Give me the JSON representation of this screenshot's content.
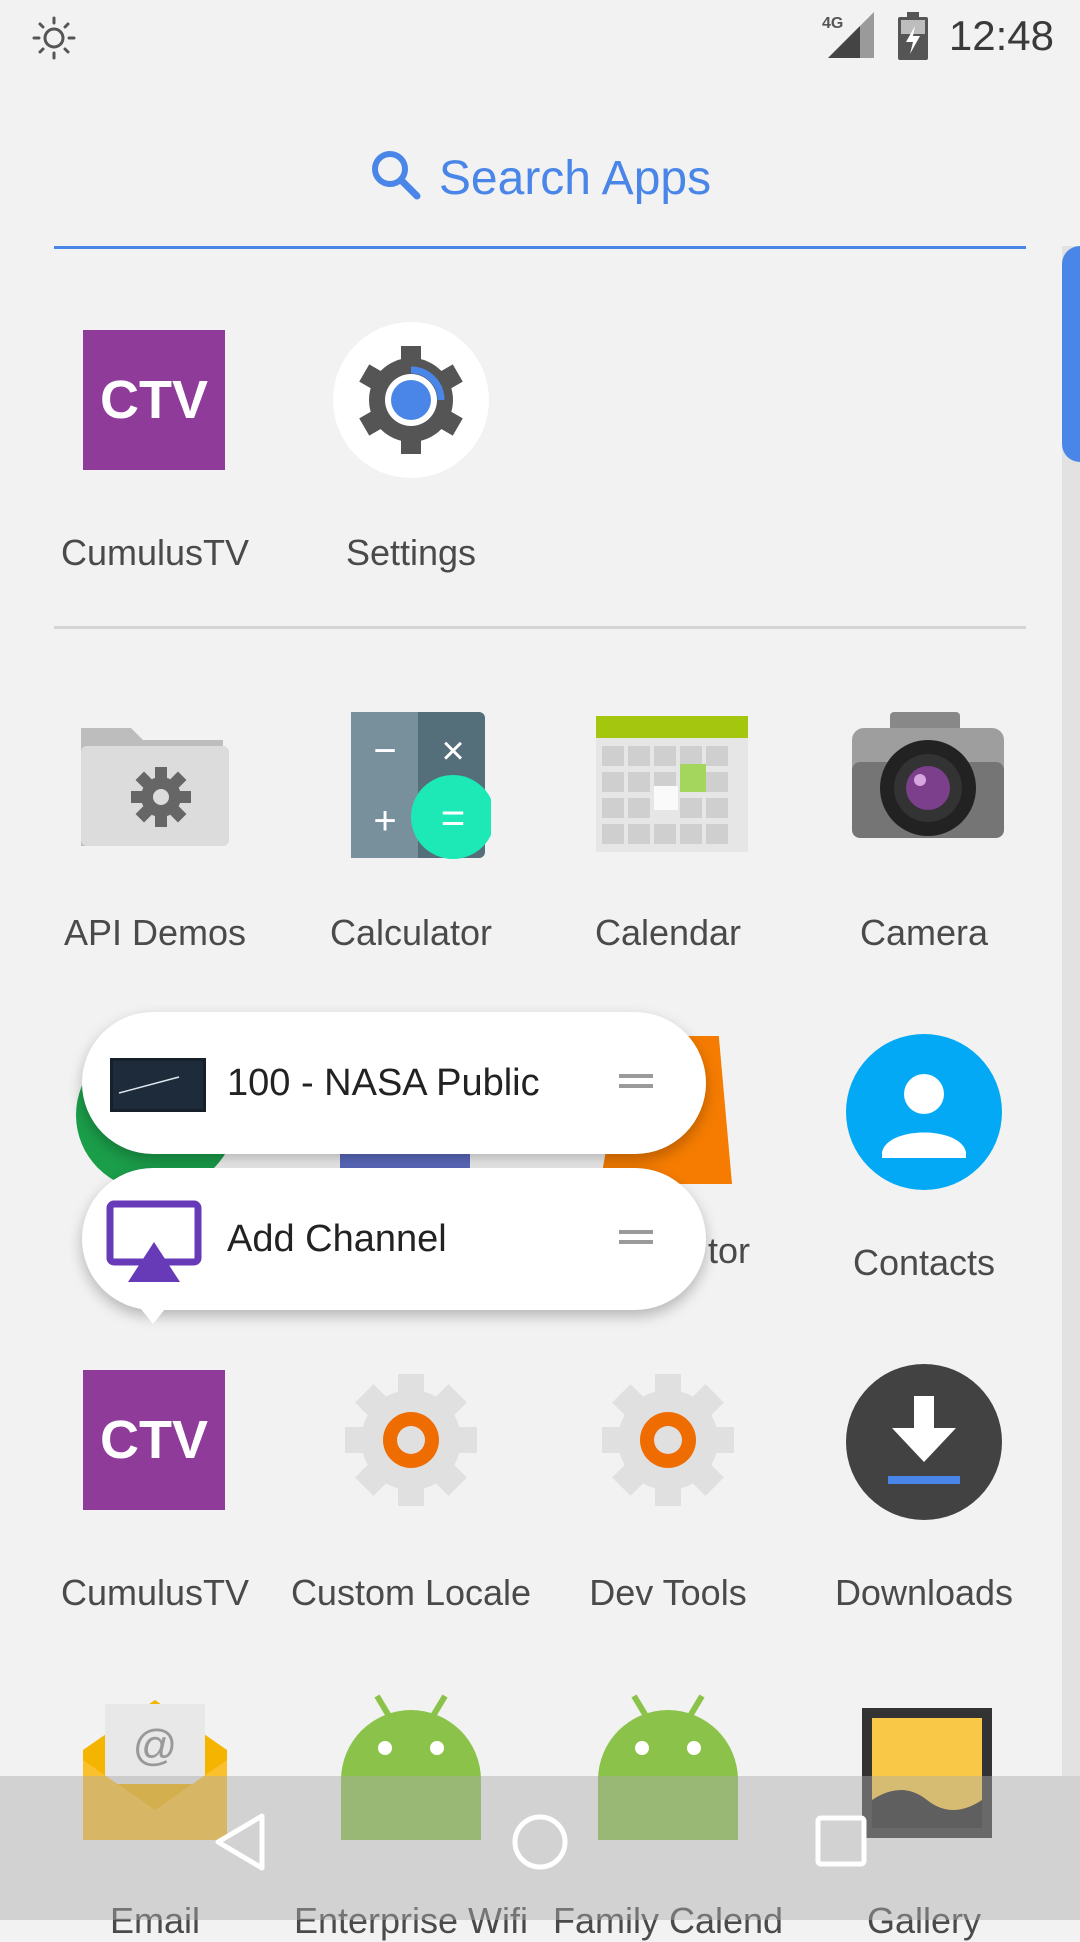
{
  "status_bar": {
    "time": "12:48",
    "network": "4G",
    "icons": [
      "brightness-icon",
      "signal-icon",
      "battery-charging-icon"
    ]
  },
  "search": {
    "placeholder": "Search Apps",
    "icon": "search-icon",
    "accent_color": "#4a86e8"
  },
  "predicted_apps": [
    {
      "label": "CumulusTV",
      "icon": "ctv-icon"
    },
    {
      "label": "Settings",
      "icon": "settings-gear-icon"
    }
  ],
  "apps": [
    {
      "label": "API Demos",
      "icon": "folder-gear-icon"
    },
    {
      "label": "Calculator",
      "icon": "calculator-icon"
    },
    {
      "label": "Calendar",
      "icon": "calendar-icon"
    },
    {
      "label": "Camera",
      "icon": "camera-icon"
    },
    {
      "label": "tor",
      "icon": "partial-app-icon"
    },
    {
      "label": "Contacts",
      "icon": "contacts-icon"
    },
    {
      "label": "CumulusTV",
      "icon": "ctv-icon"
    },
    {
      "label": "Custom Locale",
      "icon": "gear-icon"
    },
    {
      "label": "Dev Tools",
      "icon": "gear-icon"
    },
    {
      "label": "Downloads",
      "icon": "download-icon"
    },
    {
      "label": "Email",
      "icon": "email-icon"
    },
    {
      "label": "Enterprise Wifi",
      "icon": "android-icon"
    },
    {
      "label": "Family Calend",
      "icon": "android-icon"
    },
    {
      "label": "Gallery",
      "icon": "gallery-icon"
    }
  ],
  "shortcut_popup": [
    {
      "label": "100 - NASA Public",
      "icon": "channel-thumbnail-icon"
    },
    {
      "label": "Add Channel",
      "icon": "cast-channel-icon"
    }
  ],
  "ctv_text": "CTV",
  "navigation": [
    "back-icon",
    "home-icon",
    "recents-icon"
  ]
}
